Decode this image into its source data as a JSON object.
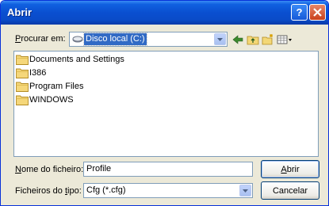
{
  "window": {
    "title": "Abrir"
  },
  "lookin": {
    "label_pre": "",
    "label_ul": "P",
    "label_post": "rocurar em:",
    "value": "Disco local (C:)"
  },
  "files": [
    {
      "name": "Documents and Settings"
    },
    {
      "name": "I386"
    },
    {
      "name": "Program Files"
    },
    {
      "name": "WINDOWS"
    }
  ],
  "filename": {
    "label_ul": "N",
    "label_post": "ome do ficheiro:",
    "value": "Profile"
  },
  "filetype": {
    "label_pre": "Ficheiros do ",
    "label_ul": "t",
    "label_post": "ipo:",
    "value": "Cfg (*.cfg)"
  },
  "buttons": {
    "open_ul": "A",
    "open_post": "brir",
    "cancel": "Cancelar"
  },
  "icons": [
    "help-icon",
    "close-icon",
    "drive-icon",
    "back-icon",
    "up-folder-icon",
    "new-folder-icon",
    "view-menu-icon",
    "folder-icon",
    "chevron-down-icon"
  ],
  "colors": {
    "titlebar": "#0a4fd0",
    "selection": "#316ac5",
    "dialog": "#ece9d8"
  }
}
